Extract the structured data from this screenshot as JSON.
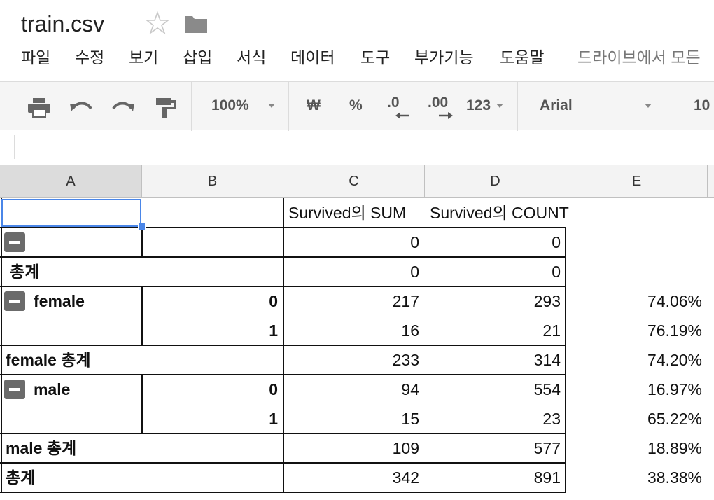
{
  "doc": {
    "title": "train.csv"
  },
  "menu": {
    "items": [
      "파일",
      "수정",
      "보기",
      "삽입",
      "서식",
      "데이터",
      "도구",
      "부가기능",
      "도움말"
    ],
    "drive_status": "드라이브에서 모든"
  },
  "toolbar": {
    "zoom": "100%",
    "currency": "₩",
    "percent": "%",
    "decimal_decrease": ".0",
    "decimal_increase": ".00",
    "more_formats": "123",
    "font": "Arial",
    "font_size": "10"
  },
  "grid": {
    "columns": [
      "A",
      "B",
      "C",
      "D",
      "E"
    ],
    "header_row": {
      "c": "Survived의 SUM",
      "d": "Survived의 COUNT"
    },
    "rows": [
      {
        "a": "",
        "b": "",
        "c": "0",
        "d": "0",
        "e": ""
      },
      {
        "a": "총계",
        "b": "",
        "c": "0",
        "d": "0",
        "e": ""
      },
      {
        "a": "female",
        "b": "0",
        "c": "217",
        "d": "293",
        "e": "74.06%"
      },
      {
        "a": "",
        "b": "1",
        "c": "16",
        "d": "21",
        "e": "76.19%"
      },
      {
        "a": "female 총계",
        "b": "",
        "c": "233",
        "d": "314",
        "e": "74.20%"
      },
      {
        "a": "male",
        "b": "0",
        "c": "94",
        "d": "554",
        "e": "16.97%"
      },
      {
        "a": "",
        "b": "1",
        "c": "15",
        "d": "23",
        "e": "65.22%"
      },
      {
        "a": "male 총계",
        "b": "",
        "c": "109",
        "d": "577",
        "e": "18.89%"
      },
      {
        "a": "총계",
        "b": "",
        "c": "342",
        "d": "891",
        "e": "38.38%"
      }
    ]
  },
  "colors": {
    "selection": "#4a86e8",
    "header_bg": "#f3f3f3",
    "toolbar_bg": "#f5f5f5"
  }
}
